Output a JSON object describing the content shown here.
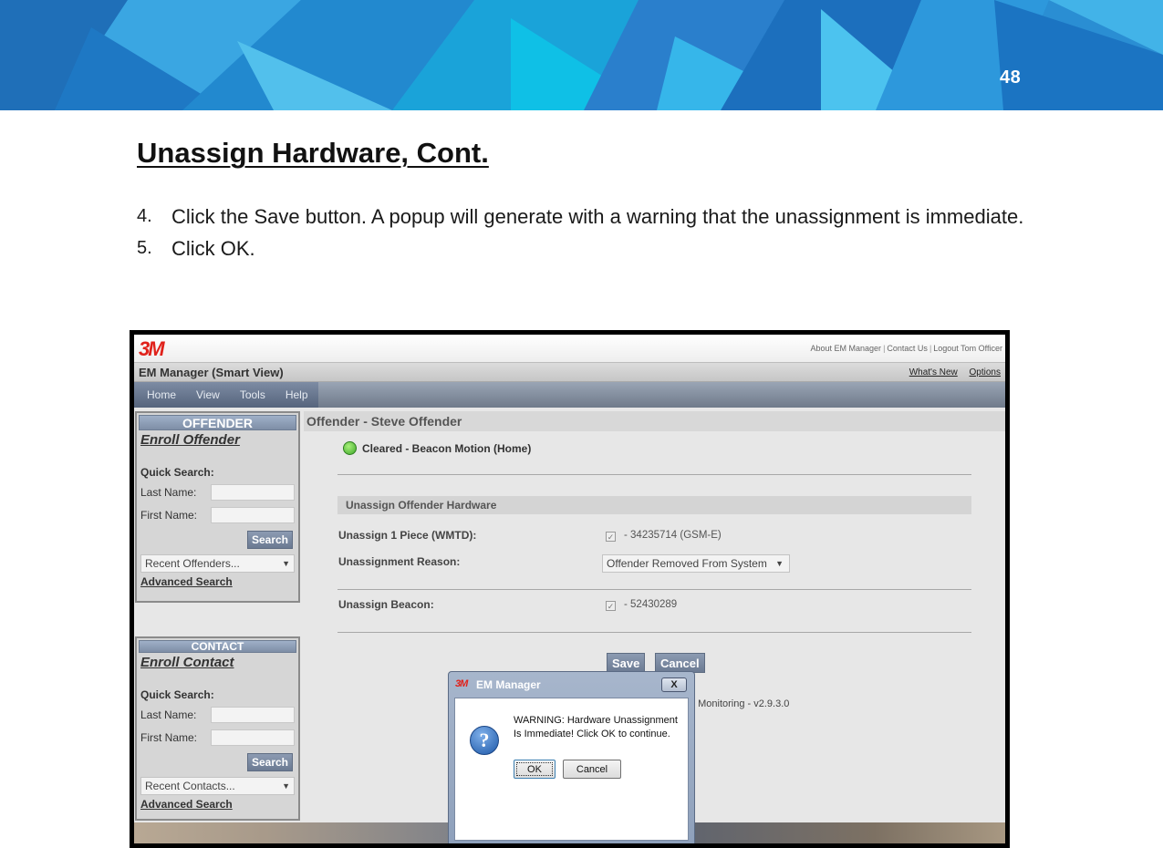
{
  "slide": {
    "page_number": "48",
    "title": "Unassign Hardware, Cont.",
    "steps": [
      {
        "number": "4.",
        "text": "Click the Save button. A popup will generate with a warning that the unassignment is immediate."
      },
      {
        "number": "5.",
        "text": "Click OK."
      }
    ]
  },
  "app": {
    "logo": "3M",
    "top_links": [
      "About EM Manager",
      "Contact Us",
      "Logout Tom Officer"
    ],
    "title": "EM Manager (Smart View)",
    "title_links": [
      "What's New",
      "Options"
    ],
    "menu": [
      "Home",
      "View",
      "Tools",
      "Help"
    ]
  },
  "offender_panel": {
    "header": "OFFENDER",
    "enroll_link": "Enroll Offender",
    "quick_search": "Quick Search:",
    "last_name_label": "Last Name:",
    "first_name_label": "First Name:",
    "search_button": "Search",
    "recent_select": "Recent Offenders...",
    "advanced_search": "Advanced Search"
  },
  "contact_panel": {
    "header": "CONTACT",
    "enroll_link": "Enroll Contact",
    "quick_search": "Quick Search:",
    "last_name_label": "Last Name:",
    "first_name_label": "First Name:",
    "search_button": "Search",
    "recent_select": "Recent Contacts...",
    "advanced_search": "Advanced Search"
  },
  "main": {
    "offender_title": "Offender - Steve Offender",
    "status": "Cleared - Beacon Motion (Home)",
    "status_color": "#3ea82a",
    "section_title": "Unassign Offender Hardware",
    "unassign_piece_label": "Unassign 1 Piece (WMTD):",
    "unassign_piece_value": "- 34235714 (GSM-E)",
    "reason_label": "Unassignment Reason:",
    "reason_value": "Offender Removed From System",
    "beacon_label": "Unassign Beacon:",
    "beacon_value": "- 52430289",
    "save_button": "Save",
    "cancel_button": "Cancel",
    "version_text": ": Monitoring - v2.9.3.0"
  },
  "dialog": {
    "logo": "3M",
    "title": "EM Manager",
    "close_label": "X",
    "message": "WARNING: Hardware Unassignment Is Immediate! Click OK to continue.",
    "ok_button": "OK",
    "cancel_button": "Cancel"
  }
}
